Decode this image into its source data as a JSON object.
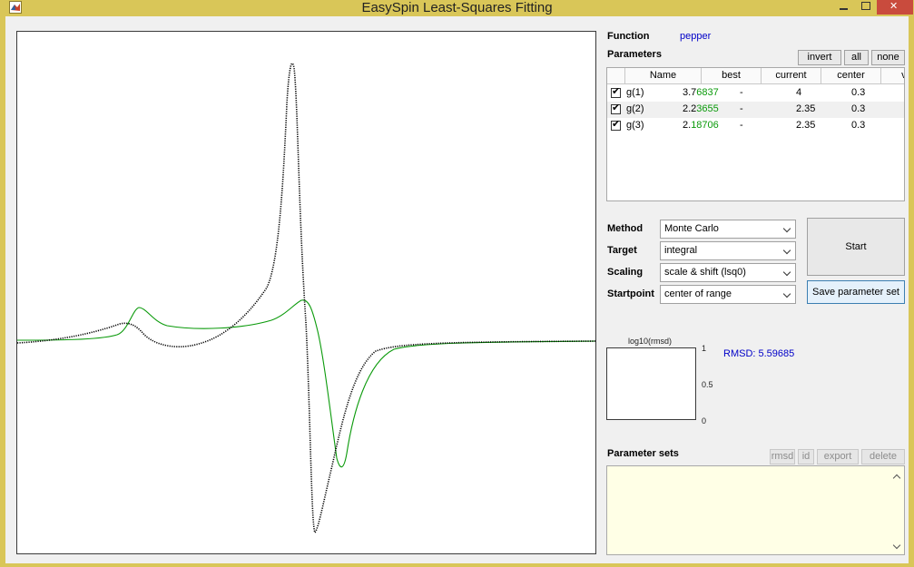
{
  "window": {
    "title": "EasySpin Least-Squares Fitting"
  },
  "function": {
    "label": "Function",
    "value": "pepper"
  },
  "parameters": {
    "label": "Parameters",
    "buttons": {
      "invert": "invert",
      "all": "all",
      "none": "none"
    },
    "columns": [
      "Name",
      "best",
      "current",
      "center",
      "vary"
    ],
    "rows": [
      {
        "checked": true,
        "name": "g(1)",
        "best_fixed": "3.7",
        "best_var": "6837",
        "current": "-",
        "center": "4",
        "vary": "0.3"
      },
      {
        "checked": true,
        "name": "g(2)",
        "best_fixed": "2.2",
        "best_var": "3655",
        "current": "-",
        "center": "2.35",
        "vary": "0.3"
      },
      {
        "checked": true,
        "name": "g(3)",
        "best_fixed": "2.",
        "best_var": "18706",
        "current": "-",
        "center": "2.35",
        "vary": "0.3"
      }
    ]
  },
  "settings": {
    "method": {
      "label": "Method",
      "value": "Monte Carlo"
    },
    "target": {
      "label": "Target",
      "value": "integral"
    },
    "scaling": {
      "label": "Scaling",
      "value": "scale & shift (lsq0)"
    },
    "startpoint": {
      "label": "Startpoint",
      "value": "center of range"
    }
  },
  "actions": {
    "start": "Start",
    "save": "Save parameter set"
  },
  "rmsd_plot": {
    "title": "log10(rmsd)",
    "ticks": [
      "1",
      "0.5",
      "0"
    ],
    "readout": "RMSD: 5.59685"
  },
  "parameter_sets": {
    "label": "Parameter sets",
    "buttons": {
      "rmsd": "rmsd",
      "id": "id",
      "export": "export",
      "delete": "delete"
    }
  },
  "colors": {
    "experimental": "#000000",
    "simulated": "#0a9a0a",
    "accent": "#0000c8"
  }
}
